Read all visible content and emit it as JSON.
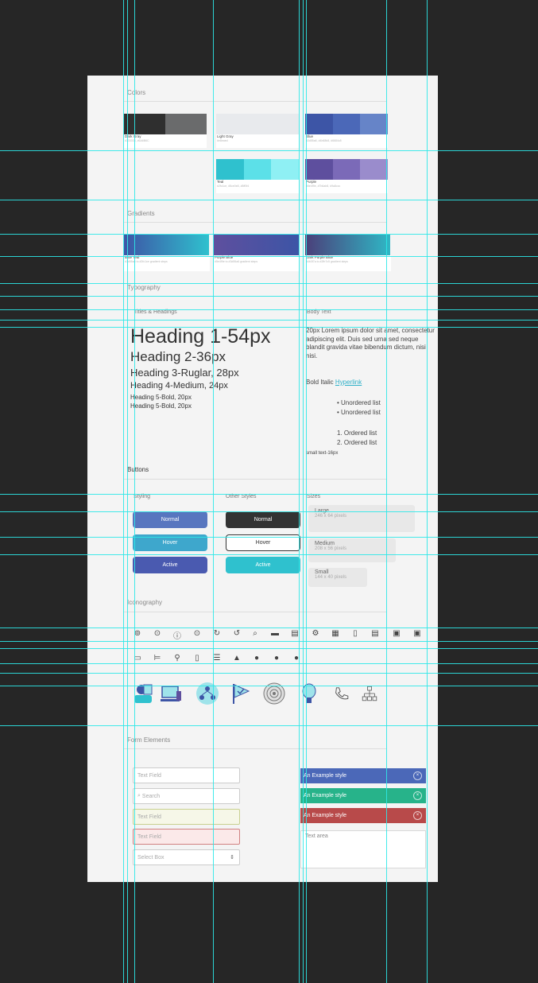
{
  "colors": {
    "title": "Colors",
    "groups": [
      {
        "label": "Dark Gray",
        "sub": "#333333, #6A6B6C",
        "swatches": [
          "#2f2f2f",
          "#6a6b6c"
        ]
      },
      {
        "label": "Light Gray",
        "sub": "#e8eaed",
        "swatches": [
          "#e8eaed",
          "#e8eaed",
          "#e8eaed"
        ]
      },
      {
        "label": "Blue",
        "sub": "#3d55a6, #4b68b8, #6684c8",
        "swatches": [
          "#3d55a6",
          "#4b68b8",
          "#6684c8"
        ]
      },
      {
        "label": "Teal",
        "sub": "#2fc1ce, #5ce0e8, #8ff0f4",
        "swatches": [
          "#2fc1ce",
          "#5ce0e8",
          "#8ff0f4"
        ]
      },
      {
        "label": "Purple",
        "sub": "#5e4f9e, #7b6ab8, #9a8ccc",
        "swatches": [
          "#5e4f9e",
          "#7b6ab8",
          "#9a8ccc"
        ]
      }
    ]
  },
  "gradients": {
    "title": "Gradients",
    "items": [
      {
        "label": "Blue Teal",
        "sub": "#3d55a6 to #2fc1ce gradient steps",
        "from": "#3d55a6",
        "to": "#2fc1ce"
      },
      {
        "label": "Purple Blue",
        "sub": "#5e4f9e to #3d55a6 gradient steps",
        "from": "#5e4f9e",
        "to": "#3d55a6"
      },
      {
        "label": "Dark Purple Blue",
        "sub": "#4b3f7a to #2fb7c5 gradient steps",
        "from": "#4b3f7a",
        "to": "#2fb7c5"
      }
    ]
  },
  "typography": {
    "title": "Typography",
    "titles_heading": "Titles & Headings",
    "body_heading": "Body Text",
    "h1": "Heading 1-54px",
    "h2": "Heading 2-36px",
    "h3": "Heading 3-Ruglar, 28px",
    "h4": "Heading 4-Medium, 24px",
    "h5a": "Heading 5-Bold, 20px",
    "h5b": "Heading 5-Bold, 20px",
    "body": "20px Lorem ipsum dolor sit amet, consectetur adipiscing elit. Duis sed urna sed neque blandit gravida vitae bibendum dictum, nisi nisi.",
    "bold_italic": "Bold Italic ",
    "hyperlink": "Hyperlink",
    "ul": [
      "Unordered list",
      "Unordered list"
    ],
    "ol": [
      "1. Ordered list",
      "2. Ordered list"
    ],
    "small": "small text-16px"
  },
  "buttons": {
    "title": "Buttons",
    "styling": "Styling",
    "other": "Other Styles",
    "sizes": "Sizes",
    "normal": "Normal",
    "hover": "Hover",
    "active": "Active",
    "large": "Large",
    "large_size": "246 x 64 pixels",
    "medium": "Medium",
    "medium_size": "208 x 56 pixels",
    "small": "Small",
    "small_size": "144 x 40 pixels",
    "colors": {
      "blue": "#4b68b8",
      "teal": "#2fc1ce",
      "purple": "#5e4f9e",
      "dark": "#333333"
    }
  },
  "iconography": {
    "title": "Iconography"
  },
  "forms": {
    "title": "Form Elements",
    "text_field": "Text Field",
    "search": "Search",
    "valid": "Text Field",
    "error": "Text Field",
    "select": "Select Box",
    "alerts": [
      {
        "label": "An Example style",
        "color": "#4b68b8"
      },
      {
        "label": "An Example style",
        "color": "#27b38a"
      },
      {
        "label": "An Example style",
        "color": "#b84a4a"
      }
    ],
    "textarea": "Text area"
  }
}
